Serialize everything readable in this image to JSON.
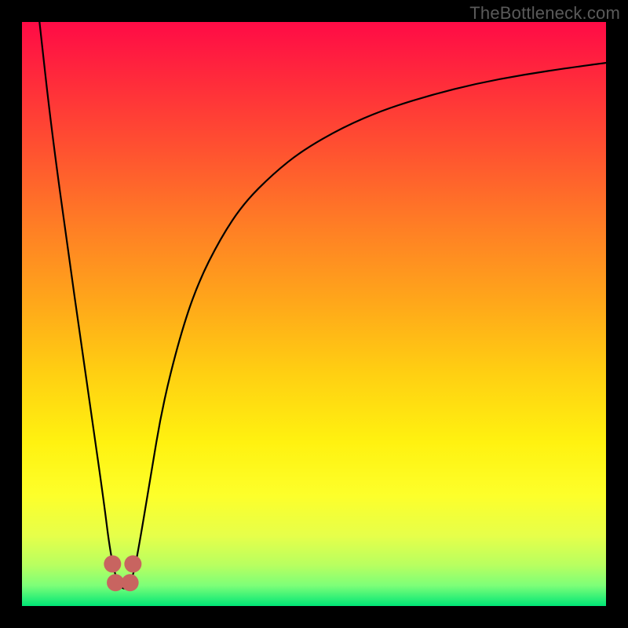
{
  "watermark": "TheBottleneck.com",
  "chart_data": {
    "type": "line",
    "title": "",
    "xlabel": "",
    "ylabel": "",
    "xlim": [
      0,
      100
    ],
    "ylim": [
      0,
      100
    ],
    "series": [
      {
        "name": "bottleneck-curve",
        "x": [
          3,
          5,
          8,
          10,
          12,
          14,
          15,
          16,
          17,
          18,
          19,
          20,
          22,
          24,
          27,
          30,
          34,
          38,
          43,
          48,
          55,
          62,
          70,
          78,
          86,
          94,
          100
        ],
        "values": [
          100,
          82,
          60,
          46,
          32,
          18,
          10,
          5,
          3,
          3,
          5,
          10,
          22,
          34,
          46,
          55,
          63,
          69,
          74,
          78,
          82,
          85,
          87.5,
          89.5,
          91,
          92.2,
          93
        ]
      }
    ],
    "markers": [
      {
        "name": "valley-dot-left-upper",
        "x": 15.5,
        "y": 7.2
      },
      {
        "name": "valley-dot-left-lower",
        "x": 16.0,
        "y": 4.0
      },
      {
        "name": "valley-dot-right-lower",
        "x": 18.5,
        "y": 4.0
      },
      {
        "name": "valley-dot-right-upper",
        "x": 19.0,
        "y": 7.2
      }
    ],
    "gradient_stops": [
      {
        "offset": 0.0,
        "color": "#ff0b46"
      },
      {
        "offset": 0.1,
        "color": "#ff2b3b"
      },
      {
        "offset": 0.22,
        "color": "#ff5230"
      },
      {
        "offset": 0.35,
        "color": "#ff7e25"
      },
      {
        "offset": 0.48,
        "color": "#ffa71a"
      },
      {
        "offset": 0.6,
        "color": "#ffcf12"
      },
      {
        "offset": 0.72,
        "color": "#fff210"
      },
      {
        "offset": 0.81,
        "color": "#fdff2a"
      },
      {
        "offset": 0.88,
        "color": "#e6ff4a"
      },
      {
        "offset": 0.93,
        "color": "#b8ff60"
      },
      {
        "offset": 0.965,
        "color": "#7dff78"
      },
      {
        "offset": 1.0,
        "color": "#00e676"
      }
    ],
    "marker_color": "#c86460"
  }
}
